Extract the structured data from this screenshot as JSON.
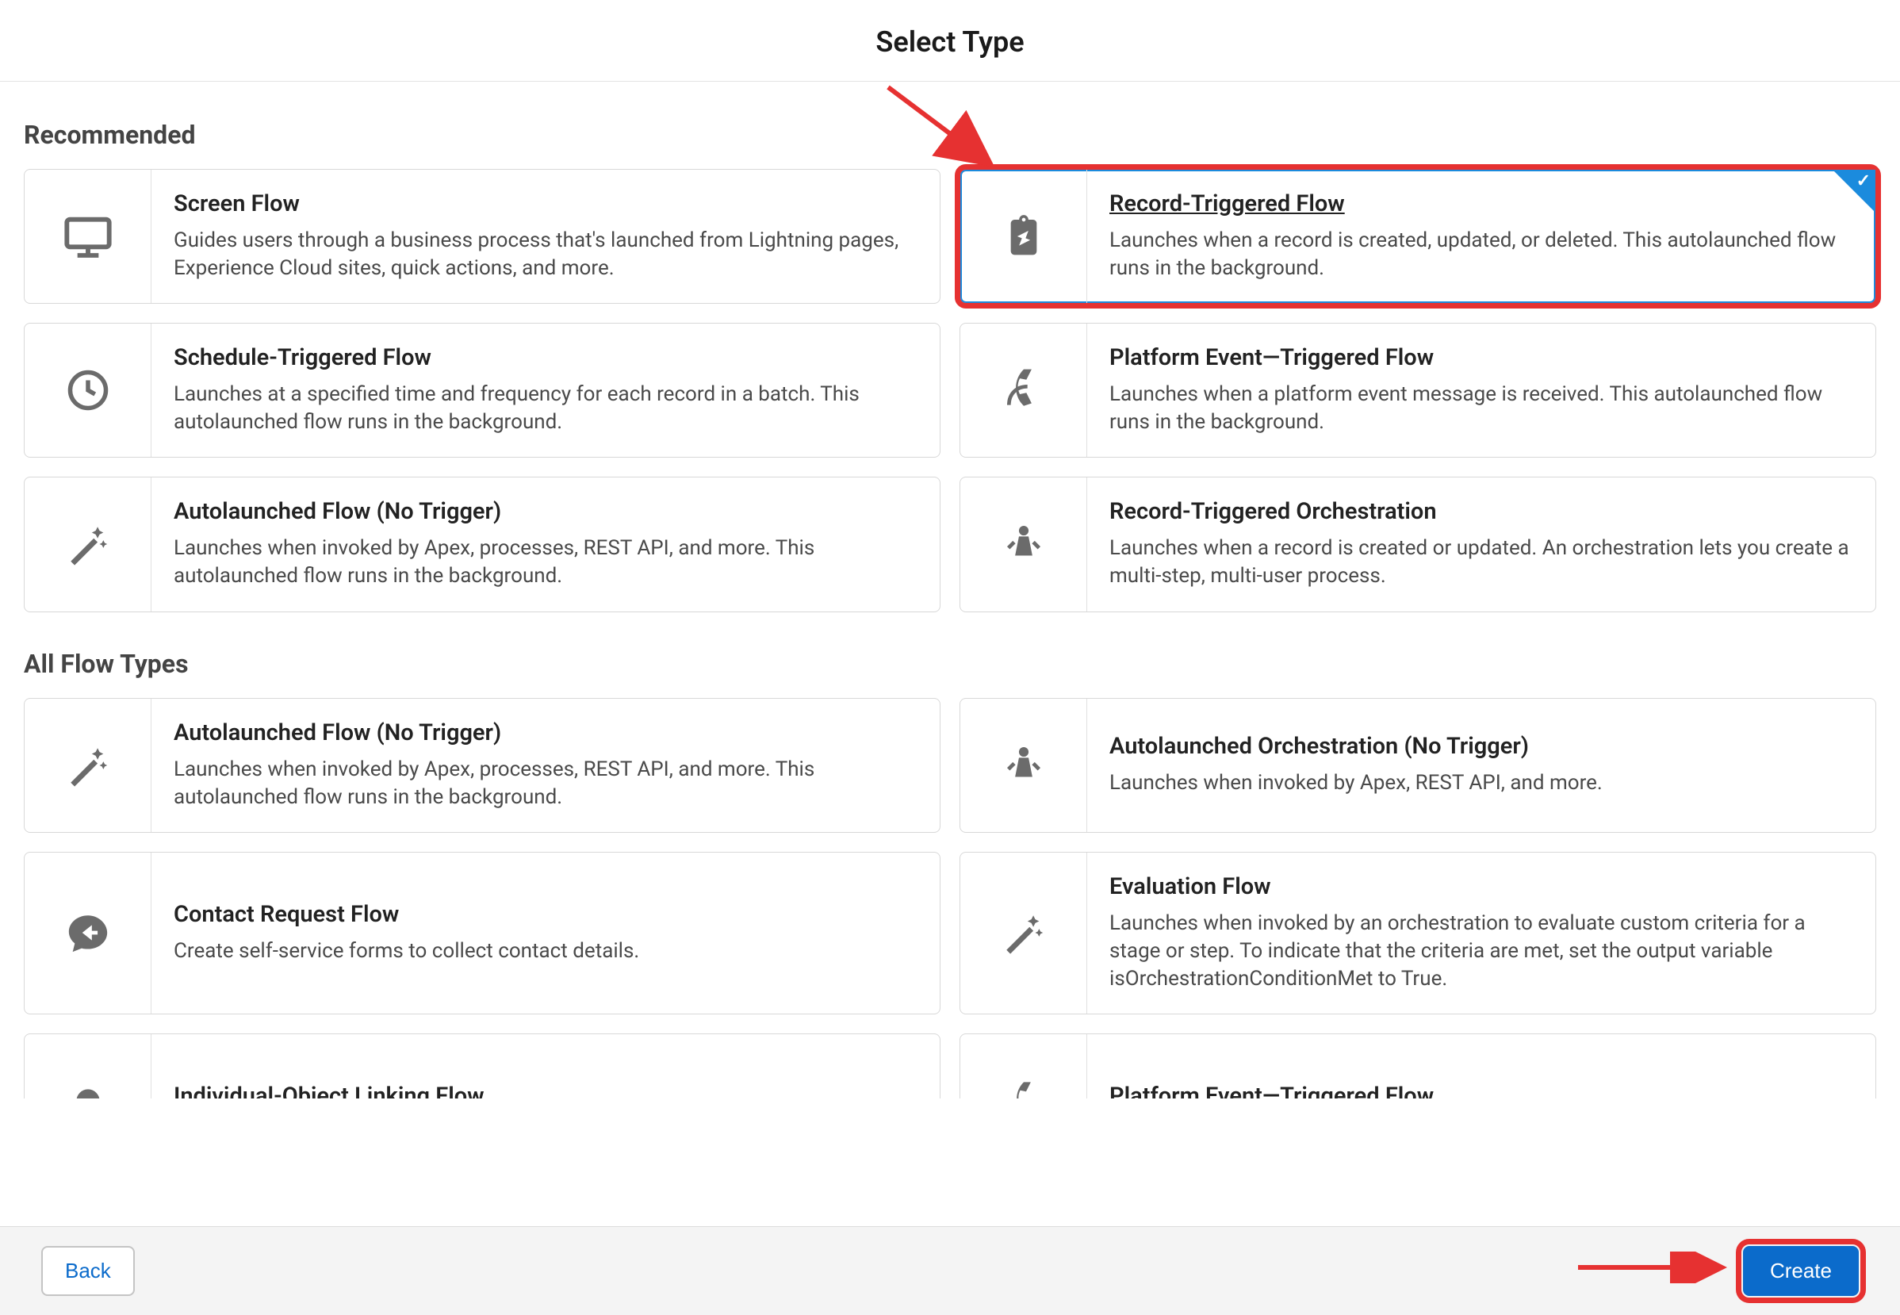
{
  "header": {
    "title": "Select Type"
  },
  "sections": {
    "recommended": "Recommended",
    "all": "All Flow Types"
  },
  "recommended": [
    {
      "title": "Screen Flow",
      "desc": "Guides users through a business process that's launched from Lightning pages, Experience Cloud sites, quick actions, and more.",
      "icon": "monitor-icon",
      "selected": false
    },
    {
      "title": "Record-Triggered Flow",
      "desc": "Launches when a record is created, updated, or deleted. This autolaunched flow runs in the background.",
      "icon": "clipboard-edit-icon",
      "selected": true
    },
    {
      "title": "Schedule-Triggered Flow",
      "desc": "Launches at a specified time and frequency for each record in a batch. This autolaunched flow runs in the background.",
      "icon": "clock-icon",
      "selected": false
    },
    {
      "title": "Platform Event—Triggered Flow",
      "desc": "Launches when a platform event message is received. This autolaunched flow runs in the background.",
      "icon": "satellite-icon",
      "selected": false
    },
    {
      "title": "Autolaunched Flow (No Trigger)",
      "desc": "Launches when invoked by Apex, processes, REST API, and more. This autolaunched flow runs in the background.",
      "icon": "wand-sparkle-icon",
      "selected": false
    },
    {
      "title": "Record-Triggered Orchestration",
      "desc": "Launches when a record is created or updated. An orchestration lets you create a multi-step, multi-user process.",
      "icon": "orchestration-icon",
      "selected": false
    }
  ],
  "all": [
    {
      "title": "Autolaunched Flow (No Trigger)",
      "desc": "Launches when invoked by Apex, processes, REST API, and more. This autolaunched flow runs in the background.",
      "icon": "wand-sparkle-icon"
    },
    {
      "title": "Autolaunched Orchestration (No Trigger)",
      "desc": "Launches when invoked by Apex, REST API, and more.",
      "icon": "orchestration-icon"
    },
    {
      "title": "Contact Request Flow",
      "desc": "Create self-service forms to collect contact details.",
      "icon": "reply-bubble-icon"
    },
    {
      "title": "Evaluation Flow",
      "desc": "Launches when invoked by an orchestration to evaluate custom criteria for a stage or step. To indicate that the criteria are met, set the output variable isOrchestrationConditionMet to True.",
      "icon": "wand-sparkle-icon"
    },
    {
      "title": "Individual-Object Linking Flow",
      "desc": "",
      "icon": "generic-icon"
    },
    {
      "title": "Platform Event—Triggered Flow",
      "desc": "",
      "icon": "satellite-icon"
    }
  ],
  "footer": {
    "back": "Back",
    "create": "Create"
  }
}
